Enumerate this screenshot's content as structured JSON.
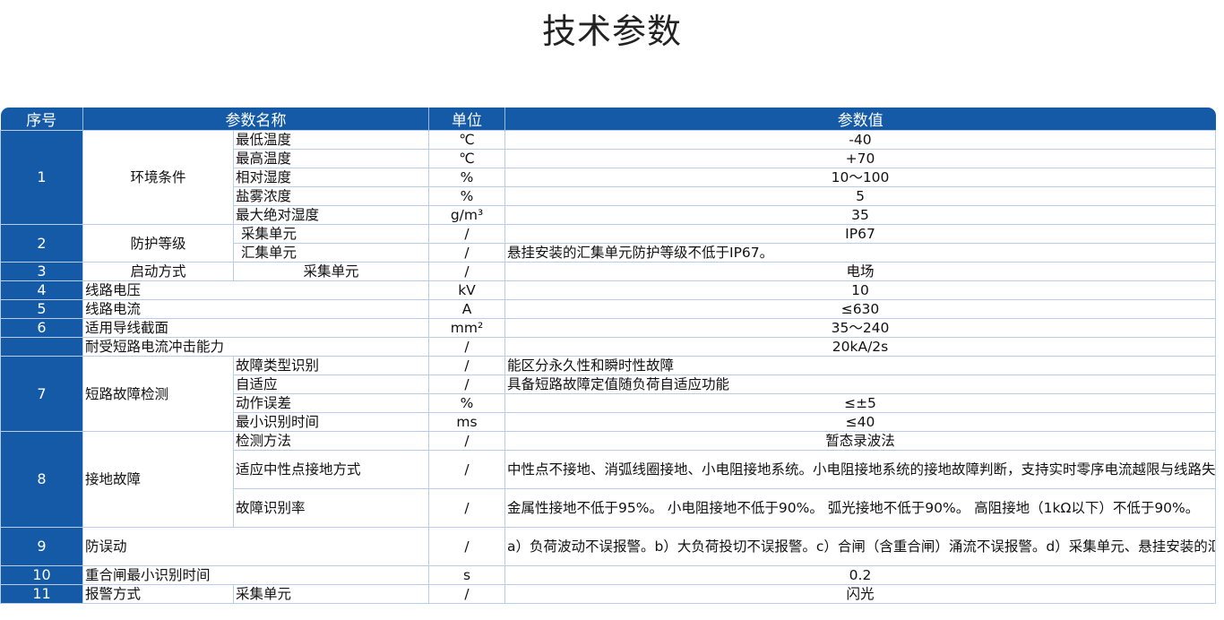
{
  "title": "技术参数",
  "headers": {
    "seq": "序号",
    "name": "参数名称",
    "unit": "单位",
    "value": "参数值"
  },
  "rows": {
    "r1": {
      "seq": "1",
      "name": "环境条件",
      "subs": [
        {
          "sub": "最低温度",
          "unit": "℃",
          "value": "-40"
        },
        {
          "sub": "最高温度",
          "unit": "℃",
          "value": "+70"
        },
        {
          "sub": "相对湿度",
          "unit": "%",
          "value": "10～100"
        },
        {
          "sub": "盐雾浓度",
          "unit": "%",
          "value": "5"
        },
        {
          "sub": "最大绝对湿度",
          "unit": "g/m³",
          "value": "35"
        }
      ]
    },
    "r2": {
      "seq": "2",
      "name": "防护等级",
      "subs": [
        {
          "sub": "采集单元",
          "unit": "/",
          "value": "IP67"
        },
        {
          "sub": "汇集单元",
          "unit": "/",
          "value": "悬挂安装的汇集单元防护等级不低于IP67。"
        }
      ]
    },
    "r3": {
      "seq": "3",
      "name": "启动方式",
      "sub": "采集单元",
      "unit": "/",
      "value": "电场"
    },
    "r4": {
      "seq": "4",
      "name": "线路电压",
      "unit": "kV",
      "value": "10"
    },
    "r5": {
      "seq": "5",
      "name": "线路电流",
      "unit": "A",
      "value": "≤630"
    },
    "r6": {
      "seq": "6",
      "name": "适用导线截面",
      "unit": "mm²",
      "value": "35～240"
    },
    "r6b": {
      "name": "耐受短路电流冲击能力",
      "unit": "/",
      "value": "20kA/2s"
    },
    "r7": {
      "seq": "7",
      "name": "短路故障检测",
      "subs": [
        {
          "sub": "故障类型识别",
          "unit": "/",
          "value": "能区分永久性和瞬时性故障"
        },
        {
          "sub": "自适应",
          "unit": "/",
          "value": "具备短路故障定值随负荷自适应功能"
        },
        {
          "sub": "动作误差",
          "unit": "%",
          "value": "≤±5"
        },
        {
          "sub": "最小识别时间",
          "unit": "ms",
          "value": "≤40"
        }
      ]
    },
    "r8": {
      "seq": "8",
      "name": "接地故障",
      "subs": [
        {
          "sub": "检测方法",
          "unit": "/",
          "value": "暂态录波法"
        },
        {
          "sub": "适应中性点接地方式",
          "unit": "/",
          "value": "中性点不接地、消弧线圈接地、小电阻接地系统。小电阻接地系统的接地故障判断，支持实时零序电流越限与线路失压判断，零序告警应能就地指示故障"
        },
        {
          "sub": "故障识别率",
          "unit": "/",
          "value": "金属性接地不低于95%。 小电阻接地不低于90%。 弧光接地不低于90%。 高阻接地（1kΩ以下）不低于90%。"
        }
      ]
    },
    "r9": {
      "seq": "9",
      "name": "防误动",
      "unit": "/",
      "value": "a）负荷波动不误报警。b）大负荷投切不误报警。c）合闸（含重合闸）涌流不误报警。d）采集单元、悬挂安装的汇集单元带电安装拆卸不误报警。"
    },
    "r10": {
      "seq": "10",
      "name": "重合闸最小识别时间",
      "unit": "s",
      "value": "0.2"
    },
    "r11": {
      "seq": "11",
      "name": "报警方式",
      "sub": "采集单元",
      "unit": "/",
      "value": "闪光"
    }
  }
}
